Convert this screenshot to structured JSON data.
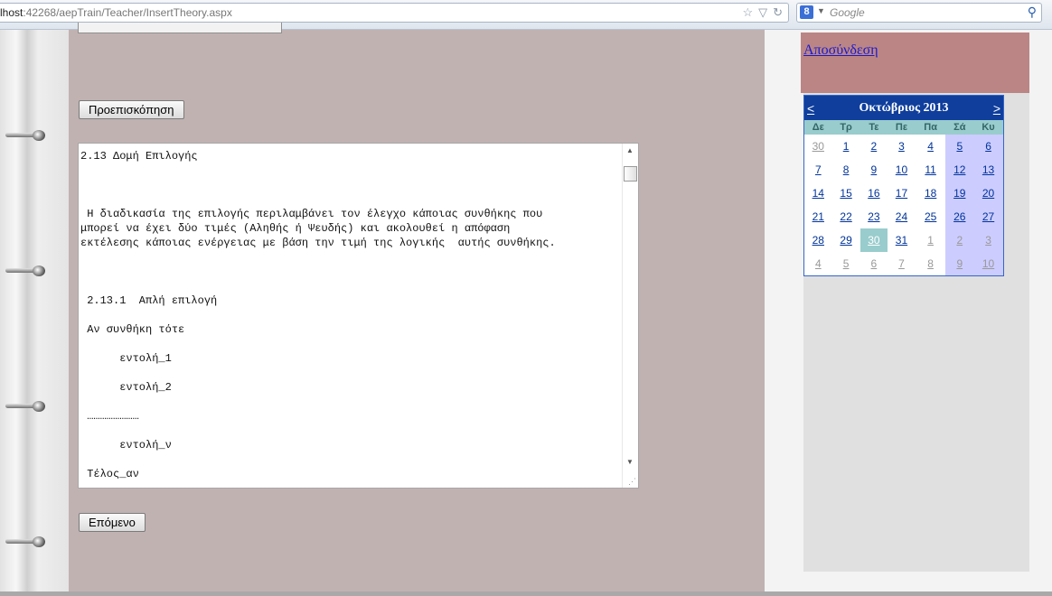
{
  "browser": {
    "url_host": "lhost",
    "url_path": ":42268/aepTrain/Teacher/InsertTheory.aspx",
    "search_placeholder": "Google",
    "search_engine_letter": "8"
  },
  "page": {
    "preview_button": "Προεπισκόπηση",
    "next_button": "Επόμενο",
    "editor_content": "2.13 Δομή Επιλογής\n\n\n\n Η διαδικασία της επιλογής περιλαμβάνει τον έλεγχο κάποιας συνθήκης που\nμπορεί να έχει δύο τιμές (Αληθής ή Ψευδής) και ακολουθεί η απόφαση\nεκτέλεσης κάποιας ενέργειας με βάση την τιμή της λογικής  αυτής συνθήκης.\n\n\n\n 2.13.1  Απλή επιλογή\n\n Αν συνθήκη τότε\n\n      εντολή_1\n\n      εντολή_2\n\n ……………………\n\n      εντολή_ν\n\n Τέλος_αν"
  },
  "sidebar": {
    "logout_link": "Αποσύνδεση"
  },
  "calendar": {
    "title": "Οκτώβριος 2013",
    "prev": "<",
    "next": ">",
    "day_headers": [
      "Δε",
      "Τρ",
      "Τε",
      "Πε",
      "Πα",
      "Σά",
      "Κυ"
    ],
    "weeks": [
      [
        "30",
        "1",
        "2",
        "3",
        "4",
        "5",
        "6"
      ],
      [
        "7",
        "8",
        "9",
        "10",
        "11",
        "12",
        "13"
      ],
      [
        "14",
        "15",
        "16",
        "17",
        "18",
        "19",
        "20"
      ],
      [
        "21",
        "22",
        "23",
        "24",
        "25",
        "26",
        "27"
      ],
      [
        "28",
        "29",
        "30",
        "31",
        "1",
        "2",
        "3"
      ],
      [
        "4",
        "5",
        "6",
        "7",
        "8",
        "9",
        "10"
      ]
    ],
    "selected_day": "30",
    "colors": {
      "header_bg": "#0f3e9c",
      "dayheader_bg": "#99cccc",
      "weekend_bg": "#ccccff",
      "today_bg": "#99cccc",
      "link": "#003399"
    }
  }
}
